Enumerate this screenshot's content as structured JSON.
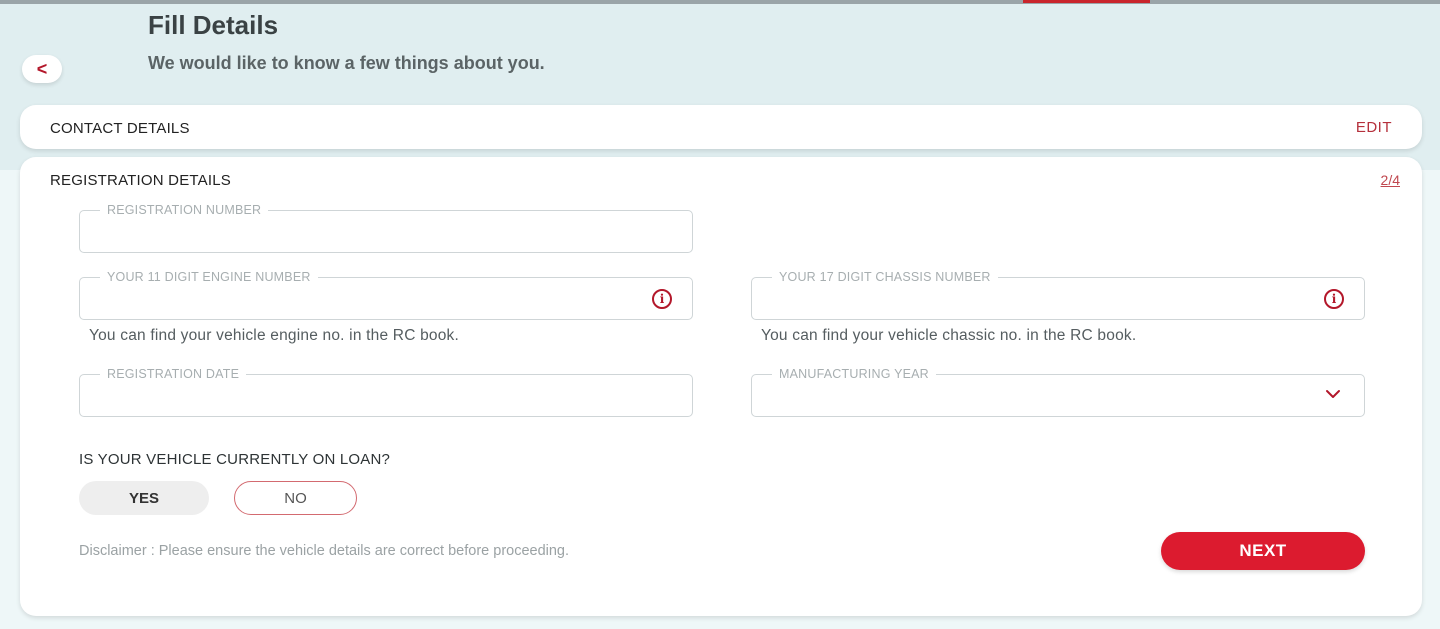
{
  "header": {
    "title": "Fill Details",
    "subtitle": "We would like to know a few things about you.",
    "back_icon": "chevron-left-icon",
    "back_glyph": "<"
  },
  "contact_section": {
    "title": "CONTACT DETAILS",
    "edit_label": "EDIT"
  },
  "registration_section": {
    "title": "REGISTRATION DETAILS",
    "step": "2/4",
    "fields": {
      "registration_number": {
        "label": "REGISTRATION NUMBER",
        "value": ""
      },
      "engine_number": {
        "label": "YOUR 11 DIGIT ENGINE NUMBER",
        "value": "",
        "hint": "You can find your vehicle engine no. in the RC book.",
        "icon": "info-icon",
        "icon_glyph": "i"
      },
      "chassis_number": {
        "label": "YOUR 17 DIGIT CHASSIS NUMBER",
        "value": "",
        "hint": "You can find your vehicle chassic no. in the RC book.",
        "icon": "info-icon",
        "icon_glyph": "i"
      },
      "registration_date": {
        "label": "REGISTRATION DATE",
        "value": ""
      },
      "manufacturing_year": {
        "label": "MANUFACTURING YEAR",
        "value": "",
        "icon": "chevron-down-icon"
      }
    },
    "loan_question": "IS YOUR VEHICLE CURRENTLY ON LOAN?",
    "loan_options": [
      {
        "label": "YES"
      },
      {
        "label": "NO"
      }
    ],
    "disclaimer": "Disclaimer : Please ensure the vehicle details are correct before proceeding.",
    "next_label": "NEXT"
  },
  "colors": {
    "accent": "#dc1b2f",
    "header_bg": "#e0eef0",
    "link": "#b5303c"
  }
}
